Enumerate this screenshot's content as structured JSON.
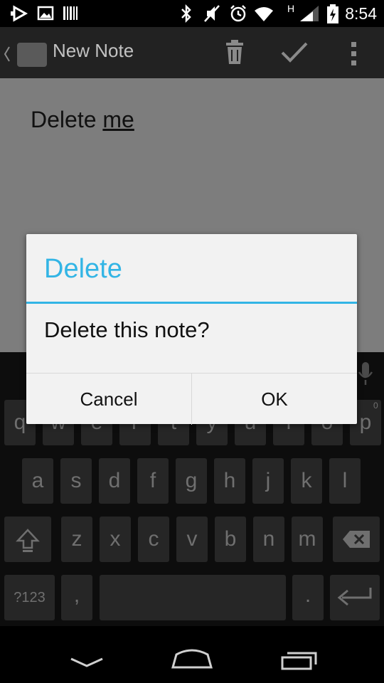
{
  "status_bar": {
    "time": "8:54",
    "network_type": "H",
    "icons": [
      "play-store-icon",
      "image-icon",
      "barcode-icon",
      "bluetooth-icon",
      "mute-icon",
      "alarm-icon",
      "wifi-icon",
      "signal-icon",
      "battery-charging-icon"
    ]
  },
  "action_bar": {
    "title": "New Note",
    "icons": [
      "back-chevron-icon",
      "app-icon",
      "trash-icon",
      "check-icon",
      "overflow-menu-icon"
    ]
  },
  "note": {
    "text_plain": "Delete ",
    "text_underlined": "me"
  },
  "dialog": {
    "title": "Delete",
    "message": "Delete this note?",
    "cancel_label": "Cancel",
    "ok_label": "OK",
    "accent_color": "#33b5e5"
  },
  "keyboard": {
    "row1": [
      "q",
      "w",
      "e",
      "r",
      "t",
      "y",
      "u",
      "i",
      "o",
      "p"
    ],
    "row2": [
      "a",
      "s",
      "d",
      "f",
      "g",
      "h",
      "j",
      "k",
      "l"
    ],
    "row3": [
      "z",
      "x",
      "c",
      "v",
      "b",
      "n",
      "m"
    ],
    "symbols_label": "?123",
    "comma_label": ",",
    "period_label": ".",
    "p_hint": "0"
  },
  "nav_bar": {
    "icons": [
      "back-icon",
      "home-icon",
      "recents-icon"
    ]
  }
}
